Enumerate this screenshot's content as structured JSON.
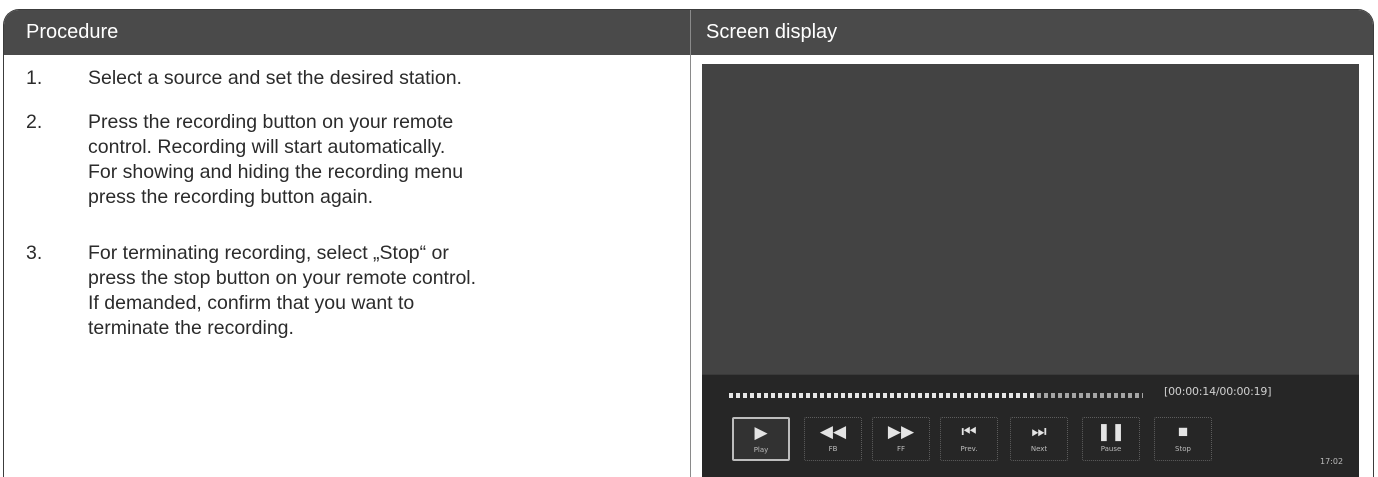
{
  "header": {
    "left": "Procedure",
    "right": "Screen display"
  },
  "steps": [
    {
      "num": "1.",
      "lines": [
        "Select a source and set the desired station."
      ]
    },
    {
      "num": "2.",
      "lines": [
        "Press the recording button on your remote",
        "control. Recording will start automatically.",
        "For showing and hiding the recording menu",
        "press the recording button again."
      ]
    },
    {
      "num": "3.",
      "lines": [
        "For terminating recording, select „Stop“ or",
        "press the stop button on your remote control.",
        "If demanded, confirm that you want to",
        "terminate the recording."
      ]
    }
  ],
  "player": {
    "progress_fraction": 0.737,
    "time": "[00:00:14/00:00:19]",
    "buttons": [
      {
        "name": "play",
        "icon": "▶",
        "label": "Play",
        "active": true
      },
      {
        "name": "rewind",
        "icon": "◀◀",
        "label": "FB",
        "active": false
      },
      {
        "name": "fast-forward",
        "icon": "▶▶",
        "label": "FF",
        "active": false
      },
      {
        "name": "previous",
        "icon": "⏮",
        "label": "Prev.",
        "active": false
      },
      {
        "name": "next",
        "icon": "⏭",
        "label": "Next",
        "active": false
      },
      {
        "name": "pause",
        "icon": "❚❚",
        "label": "Pause",
        "active": false
      },
      {
        "name": "stop",
        "icon": "■",
        "label": "Stop",
        "active": false
      }
    ],
    "clock": "17:02"
  },
  "colors": {
    "header_bg": "#4a4a4a",
    "screen_bg": "#434343",
    "control_bar_bg": "#262626"
  }
}
